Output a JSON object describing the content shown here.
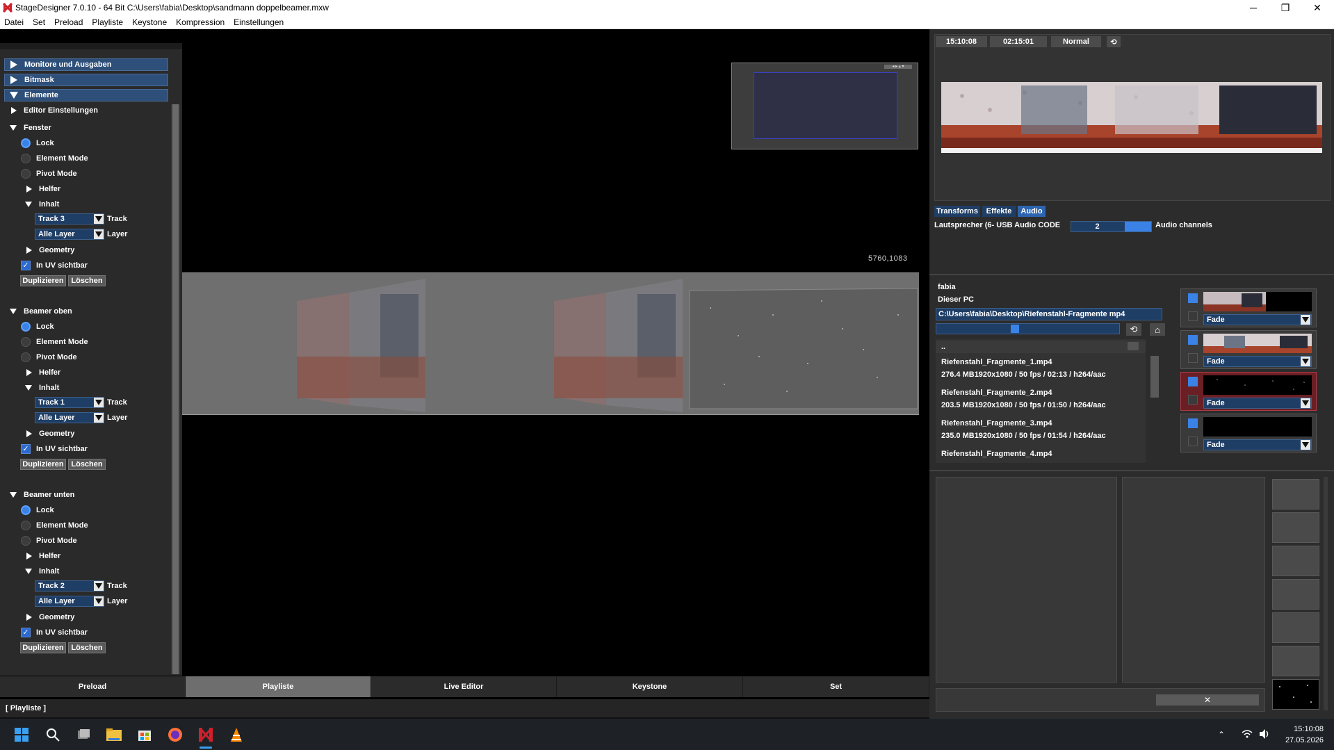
{
  "window": {
    "title": "StageDesigner 7.0.10 - 64 Bit C:\\Users\\fabia\\Desktop\\sandmann doppelbeamer.mxw",
    "controls": {
      "minimize": "─",
      "maximize": "❐",
      "close": "✕"
    }
  },
  "menu": [
    "Datei",
    "Set",
    "Preload",
    "Playliste",
    "Keystone",
    "Kompression",
    "Einstellungen"
  ],
  "left_panel": {
    "sections": [
      {
        "label": "Monitore und Ausgaben"
      },
      {
        "label": "Bitmask"
      },
      {
        "label": "Elemente"
      }
    ],
    "editor_settings": "Editor Einstellungen",
    "groups": [
      {
        "title": "Fenster",
        "lock": "Lock",
        "element_mode": "Element Mode",
        "pivot_mode": "Pivot Mode",
        "helfer": "Helfer",
        "inhalt": "Inhalt",
        "track_value": "Track 3",
        "track_label": "Track",
        "layer_value": "Alle Layer",
        "layer_label": "Layer",
        "geometry": "Geometry",
        "uv_visible": "In UV sichtbar",
        "duplicate": "Duplizieren",
        "delete": "Löschen"
      },
      {
        "title": "Beamer oben",
        "lock": "Lock",
        "element_mode": "Element Mode",
        "pivot_mode": "Pivot Mode",
        "helfer": "Helfer",
        "inhalt": "Inhalt",
        "track_value": "Track 1",
        "track_label": "Track",
        "layer_value": "Alle Layer",
        "layer_label": "Layer",
        "geometry": "Geometry",
        "uv_visible": "In UV sichtbar",
        "duplicate": "Duplizieren",
        "delete": "Löschen"
      },
      {
        "title": "Beamer unten",
        "lock": "Lock",
        "element_mode": "Element Mode",
        "pivot_mode": "Pivot Mode",
        "helfer": "Helfer",
        "inhalt": "Inhalt",
        "track_value": "Track 2",
        "track_label": "Track",
        "layer_value": "Alle Layer",
        "layer_label": "Layer",
        "geometry": "Geometry",
        "uv_visible": "In UV sichtbar",
        "duplicate": "Duplizieren",
        "delete": "Löschen"
      }
    ]
  },
  "viewport": {
    "coordinates": "5760,1083",
    "minimap_controls": "◂ ▸ ▴ ▾"
  },
  "bottom_tabs": [
    {
      "label": "Preload",
      "active": false
    },
    {
      "label": "Playliste",
      "active": true
    },
    {
      "label": "Live Editor",
      "active": false
    },
    {
      "label": "Keystone",
      "active": false
    },
    {
      "label": "Set",
      "active": false
    }
  ],
  "status": "[ Playliste ]",
  "right_panel": {
    "time_current": "15:10:08",
    "time_remaining": "02:15:01",
    "mode": "Normal",
    "tabs": [
      "Transforms",
      "Effekte",
      "Audio"
    ],
    "active_tab": "Audio",
    "audio_device": "Lautsprecher (6- USB Audio CODE",
    "audio_channels_value": "2",
    "audio_channels_label": "Audio channels"
  },
  "file_browser": {
    "user": "fabia",
    "location": "Dieser PC",
    "path": "C:\\Users\\fabia\\Desktop\\Riefenstahl-Fragmente mp4",
    "parent": "..",
    "files": [
      {
        "name": "Riefenstahl_Fragmente_1.mp4",
        "info": "276.4 MB1920x1080 / 50 fps / 02:13 / h264/aac"
      },
      {
        "name": "Riefenstahl_Fragmente_2.mp4",
        "info": "203.5 MB1920x1080 / 50 fps / 01:50 / h264/aac"
      },
      {
        "name": "Riefenstahl_Fragmente_3.mp4",
        "info": "235.0 MB1920x1080 / 50 fps / 01:54 / h264/aac"
      },
      {
        "name": "Riefenstahl_Fragmente_4.mp4",
        "info": ""
      }
    ]
  },
  "clip_slots": [
    {
      "transition": "Fade",
      "selected": false
    },
    {
      "transition": "Fade",
      "selected": false
    },
    {
      "transition": "Fade",
      "selected": true
    },
    {
      "transition": "Fade",
      "selected": false
    }
  ],
  "lower_right": {
    "close_glyph": "✕"
  },
  "taskbar": {
    "time": "15:10:08",
    "date": "27.05.2026"
  },
  "colors": {
    "accent_blue": "#3b82e6",
    "panel_blue": "#1f3e66",
    "selected_red": "#6a1f24"
  }
}
